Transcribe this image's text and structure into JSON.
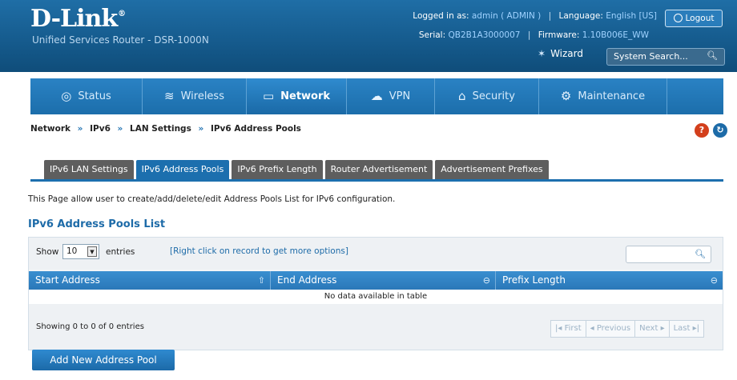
{
  "header": {
    "logo": "D-Link",
    "logo_reg": "®",
    "subtitle": "Unified Services Router - DSR-1000N",
    "logged_in_label": "Logged in as:",
    "logged_in_value": "admin ( ADMIN )",
    "language_label": "Language:",
    "language_value": "English [US]",
    "serial_label": "Serial:",
    "serial_value": "QB2B1A3000007",
    "firmware_label": "Firmware:",
    "firmware_value": "1.10B006E_WW",
    "logout_label": "Logout",
    "wizard_label": "Wizard",
    "search_placeholder": "System Search..."
  },
  "nav": {
    "items": [
      {
        "label": "Status",
        "icon": "status-icon"
      },
      {
        "label": "Wireless",
        "icon": "wireless-icon"
      },
      {
        "label": "Network",
        "icon": "network-icon",
        "active": true
      },
      {
        "label": "VPN",
        "icon": "vpn-icon"
      },
      {
        "label": "Security",
        "icon": "security-icon"
      },
      {
        "label": "Maintenance",
        "icon": "maintenance-icon"
      }
    ]
  },
  "breadcrumb": {
    "items": [
      "Network",
      "IPv6",
      "LAN Settings",
      "IPv6 Address Pools"
    ],
    "sep": "»"
  },
  "tabs": [
    {
      "label": "IPv6 LAN Settings"
    },
    {
      "label": "IPv6 Address Pools",
      "active": true
    },
    {
      "label": "IPv6 Prefix Length"
    },
    {
      "label": "Router Advertisement"
    },
    {
      "label": "Advertisement Prefixes"
    }
  ],
  "page": {
    "description": "This Page allow user to create/add/delete/edit Address Pools List for IPv6 configuration.",
    "list_title": "IPv6 Address Pools List"
  },
  "table": {
    "show_label": "Show",
    "show_value": "10",
    "entries_label": "entries",
    "hint": "[Right click on record to get more options]",
    "columns": [
      "Start Address",
      "End Address",
      "Prefix Length"
    ],
    "empty_message": "No data available in table",
    "showing": "Showing 0 to 0 of 0 entries",
    "pager": [
      "First",
      "Previous",
      "Next",
      "Last"
    ]
  },
  "actions": {
    "add_label": "Add New Address Pool"
  },
  "colors": {
    "brand_blue": "#1c6fae",
    "header_bg": "#155a8c",
    "tab_inactive": "#5e5e5e",
    "help_red": "#d33f1c"
  }
}
